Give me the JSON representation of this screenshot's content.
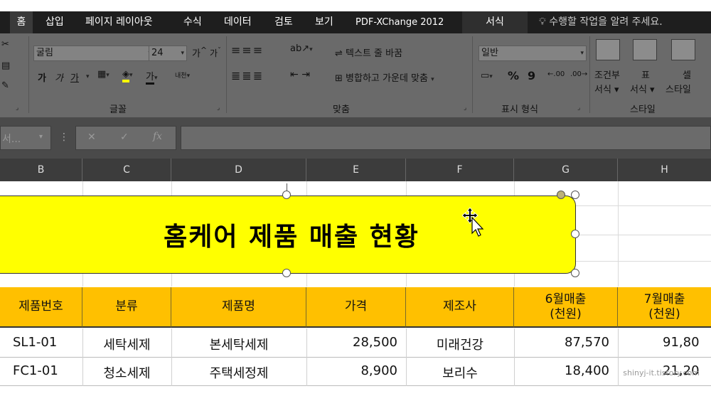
{
  "tabs": [
    "홈",
    "삽입",
    "페이지 레이아웃",
    "수식",
    "데이터",
    "검토",
    "보기",
    "PDF-XChange 2012",
    "서식"
  ],
  "active_tab": "홈",
  "tell_me": "수행할 작업을 알려 주세요.",
  "font": {
    "name": "굴림",
    "size": "24",
    "grow_label": "가",
    "shrink_label": "가",
    "bold": "가",
    "italic": "가",
    "underline": "가",
    "color_glyph": "가",
    "phonetic": "내천"
  },
  "align": {
    "wrap_text": "텍스트 줄 바꿈",
    "merge_center": "병합하고 가운데 맞춤"
  },
  "number": {
    "format": "일반",
    "percent": "%",
    "comma": "9",
    "inc_decimal": ".00",
    "dec_decimal": ".00"
  },
  "styles": {
    "cond_format_line1": "조건부",
    "cond_format_line2": "서식 ▾",
    "table_format_line1": "표",
    "table_format_line2": "서식 ▾",
    "cell_styles_line1": "셀",
    "cell_styles_line2": "스타일"
  },
  "groups": {
    "font": "글꼴",
    "align": "맞춤",
    "number": "표시 형식",
    "styles": "스타일"
  },
  "formula_bar": {
    "name_box": "서...",
    "fx": "fx",
    "cancel": "✕",
    "enter": "✓",
    "more": "⋮"
  },
  "columns": [
    "B",
    "C",
    "D",
    "E",
    "F",
    "G",
    "H"
  ],
  "shape": {
    "title": "홈케어 제품 매출 현황"
  },
  "table": {
    "headers": [
      [
        "제품번호"
      ],
      [
        "분류"
      ],
      [
        "제품명"
      ],
      [
        "가격"
      ],
      [
        "제조사"
      ],
      [
        "6월매출",
        "(천원)"
      ],
      [
        "7월매출",
        "(천원)"
      ]
    ],
    "rows": [
      [
        "SL1-01",
        "세탁세제",
        "본세탁세제",
        "28,500",
        "미래건강",
        "87,570",
        "91,80"
      ],
      [
        "FC1-01",
        "청소세제",
        "주택세정제",
        "8,900",
        "보리수",
        "18,400",
        "21,20"
      ]
    ]
  },
  "watermark": "shinyj-it.tistory.com",
  "colors": {
    "accent_yellow": "#ffff00",
    "header_orange": "#ffc000",
    "ribbon_dim": "#6a6a6a",
    "tabbar": "#1e1e1e"
  }
}
